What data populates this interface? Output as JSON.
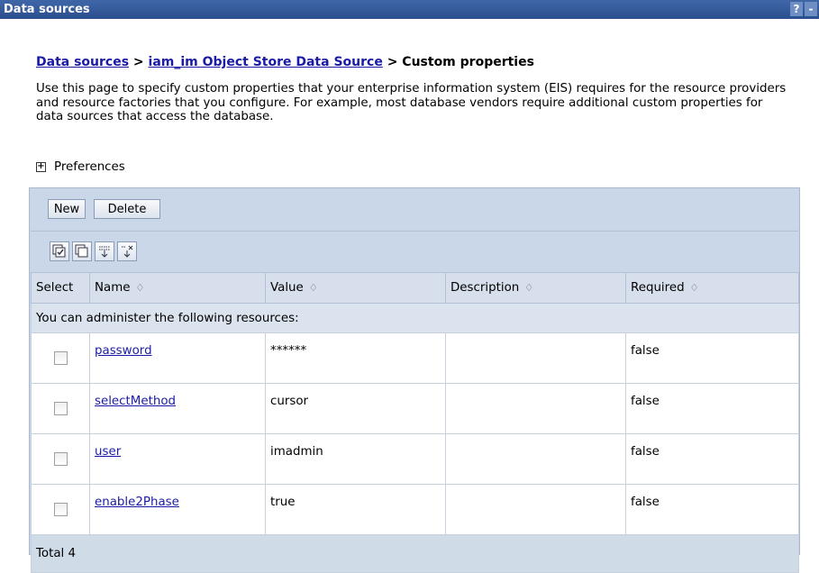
{
  "window": {
    "title": "Data sources",
    "help_label": "?",
    "minimize_label": "-"
  },
  "breadcrumb": {
    "root": "Data sources",
    "sep": ">",
    "datasource": "iam_im Object Store Data Source",
    "current": "Custom properties"
  },
  "description": "Use this page to specify custom properties that your enterprise information system (EIS) requires for the resource providers and resource factories that you configure. For example, most database vendors require additional custom properties for data sources that access the database.",
  "preferences": {
    "label": "Preferences",
    "expander": "+"
  },
  "buttons": {
    "new": "New",
    "delete": "Delete"
  },
  "icons": [
    "select-all-icon",
    "deselect-all-icon",
    "show-filter-icon",
    "clear-filter-icon"
  ],
  "table": {
    "headers": {
      "select": "Select",
      "name": "Name",
      "value": "Value",
      "description": "Description",
      "required": "Required",
      "sort_glyph": "♢"
    },
    "info": "You can administer the following resources:",
    "rows": [
      {
        "name": "password",
        "value": "******",
        "description": "",
        "required": "false"
      },
      {
        "name": "selectMethod",
        "value": "cursor",
        "description": "",
        "required": "false"
      },
      {
        "name": "user",
        "value": "imadmin",
        "description": "",
        "required": "false"
      },
      {
        "name": "enable2Phase",
        "value": "true",
        "description": "",
        "required": "false"
      }
    ],
    "total": "Total 4"
  }
}
